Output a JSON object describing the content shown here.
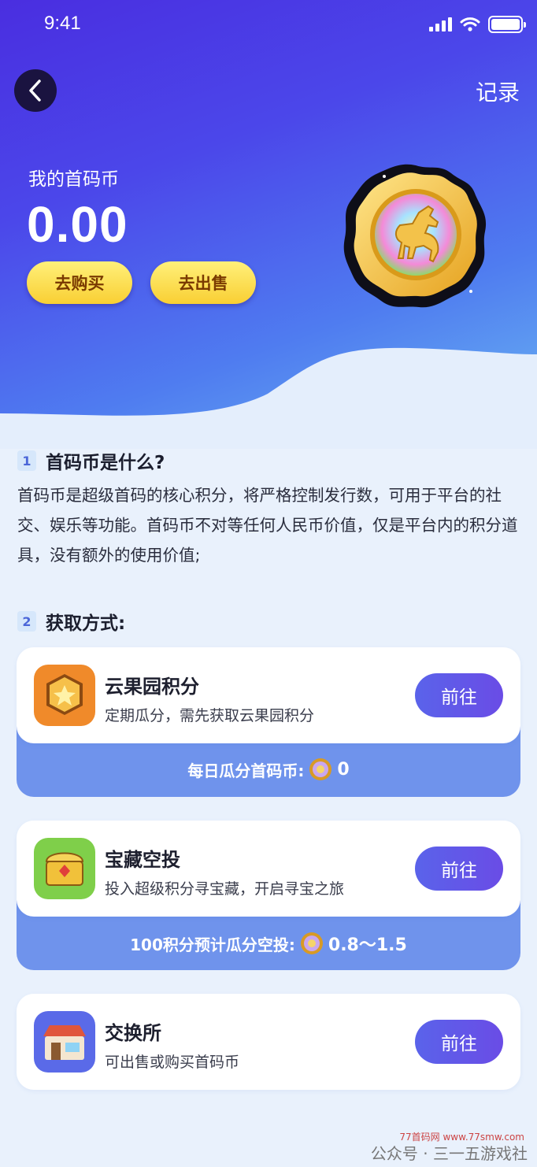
{
  "status": {
    "time": "9:41"
  },
  "header": {
    "record_label": "记录"
  },
  "wallet": {
    "label": "我的首码币",
    "balance": "0.00",
    "buy_label": "去购买",
    "sell_label": "去出售"
  },
  "section1": {
    "num": "1",
    "title": "首码币是什么?",
    "description": "首码币是超级首码的核心积分，将严格控制发行数，可用于平台的社交、娱乐等功能。首码币不对等任何人民币价值，仅是平台内的积分道具，没有额外的使用价值;"
  },
  "section2": {
    "num": "2",
    "title": "获取方式:"
  },
  "cards": [
    {
      "title": "云果园积分",
      "subtitle": "定期瓜分，需先获取云果园积分",
      "button": "前往",
      "strip_label": "每日瓜分首码币:",
      "strip_value": "0"
    },
    {
      "title": "宝藏空投",
      "subtitle": "投入超级积分寻宝藏，开启寻宝之旅",
      "button": "前往",
      "strip_label": "100积分预计瓜分空投:",
      "strip_value": "0.8～1.5"
    },
    {
      "title": "交换所",
      "subtitle": "可出售或购买首码币",
      "button": "前往"
    }
  ],
  "watermark": {
    "text": "公众号 · 三一五游戏社",
    "url": "77首码网 www.77smw.com"
  },
  "colors": {
    "primary": "#4a2ee0",
    "accent_gold": "#f9cf33",
    "strip": "#6f93ec",
    "button": "#5a63ea"
  }
}
